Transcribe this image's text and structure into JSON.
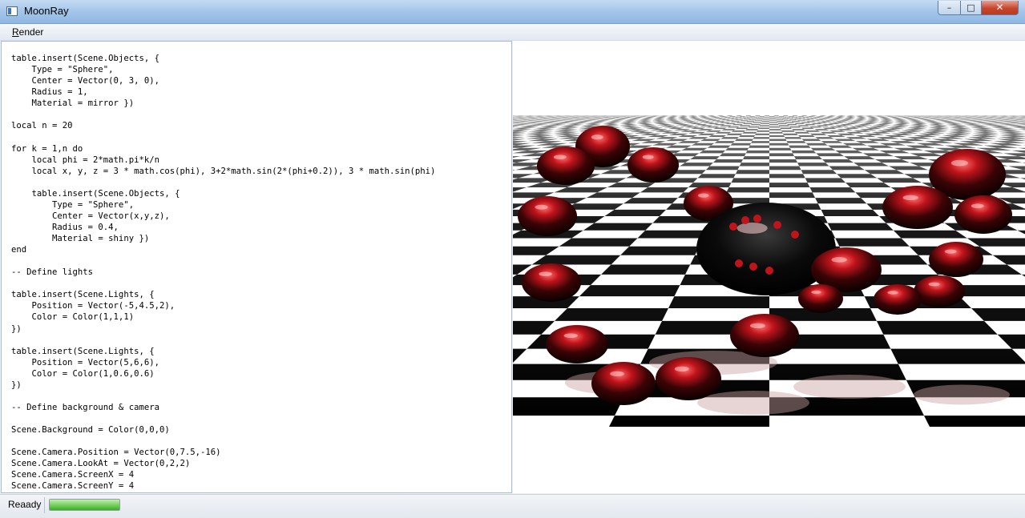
{
  "window": {
    "title": "MoonRay",
    "controls": {
      "minimize": "–",
      "maximize": "□",
      "close": "✕"
    }
  },
  "menu": {
    "items": [
      {
        "label": "Render",
        "mnemonic": "R",
        "rest": "ender"
      }
    ]
  },
  "editor": {
    "code": "table.insert(Scene.Objects, {\n    Type = \"Sphere\",\n    Center = Vector(0, 3, 0),\n    Radius = 1,\n    Material = mirror })\n\nlocal n = 20\n\nfor k = 1,n do\n    local phi = 2*math.pi*k/n\n    local x, y, z = 3 * math.cos(phi), 3+2*math.sin(2*(phi+0.2)), 3 * math.sin(phi)\n\n    table.insert(Scene.Objects, {\n        Type = \"Sphere\",\n        Center = Vector(x,y,z),\n        Radius = 0.4,\n        Material = shiny })\nend\n\n-- Define lights\n\ntable.insert(Scene.Lights, {\n    Position = Vector(-5,4.5,2),\n    Color = Color(1,1,1)\n})\n\ntable.insert(Scene.Lights, {\n    Position = Vector(5,6,6),\n    Color = Color(1,0.6,0.6)\n})\n\n-- Define background & camera\n\nScene.Background = Color(0,0,0)\n\nScene.Camera.Position = Vector(0,7.5,-16)\nScene.Camera.LookAt = Vector(0,2,2)\nScene.Camera.ScreenX = 4\nScene.Camera.ScreenY = 4"
  },
  "status": {
    "text": "Reaady",
    "progress": 1.0
  },
  "colors": {
    "sphere_red": "#c0141b",
    "floor_dark": "#000000",
    "floor_light": "#ffffff"
  }
}
